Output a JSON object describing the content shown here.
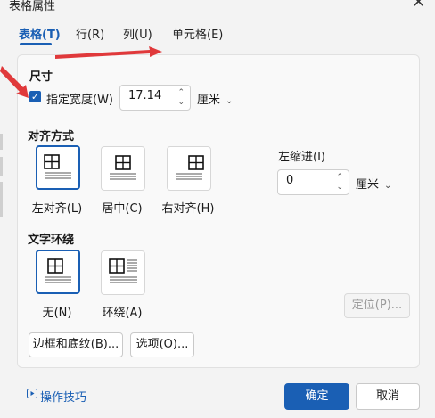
{
  "window": {
    "title": "表格属性",
    "close": "✕"
  },
  "tabs": [
    {
      "label": "表格(T)",
      "active": true
    },
    {
      "label": "行(R)",
      "active": false
    },
    {
      "label": "列(U)",
      "active": false
    },
    {
      "label": "单元格(E)",
      "active": false
    }
  ],
  "size": {
    "section": "尺寸",
    "width_checked": true,
    "width_label": "指定宽度(W)",
    "width_value": "17.14",
    "unit": "厘米"
  },
  "alignment": {
    "section": "对齐方式",
    "options": [
      {
        "label": "左对齐(L)",
        "selected": true
      },
      {
        "label": "居中(C)",
        "selected": false
      },
      {
        "label": "右对齐(H)",
        "selected": false
      }
    ],
    "indent_label": "左缩进(I)",
    "indent_value": "0",
    "indent_unit": "厘米"
  },
  "wrap": {
    "section": "文字环绕",
    "options": [
      {
        "label": "无(N)",
        "selected": true
      },
      {
        "label": "环绕(A)",
        "selected": false
      }
    ],
    "position_button": "定位(P)..."
  },
  "buttons": {
    "borders": "边框和底纹(B)...",
    "options": "选项(O)...",
    "ok": "确定",
    "cancel": "取消"
  },
  "footer": {
    "tips": "操作技巧"
  },
  "colors": {
    "accent": "#1a5fb4",
    "annotation": "#e0393b"
  }
}
